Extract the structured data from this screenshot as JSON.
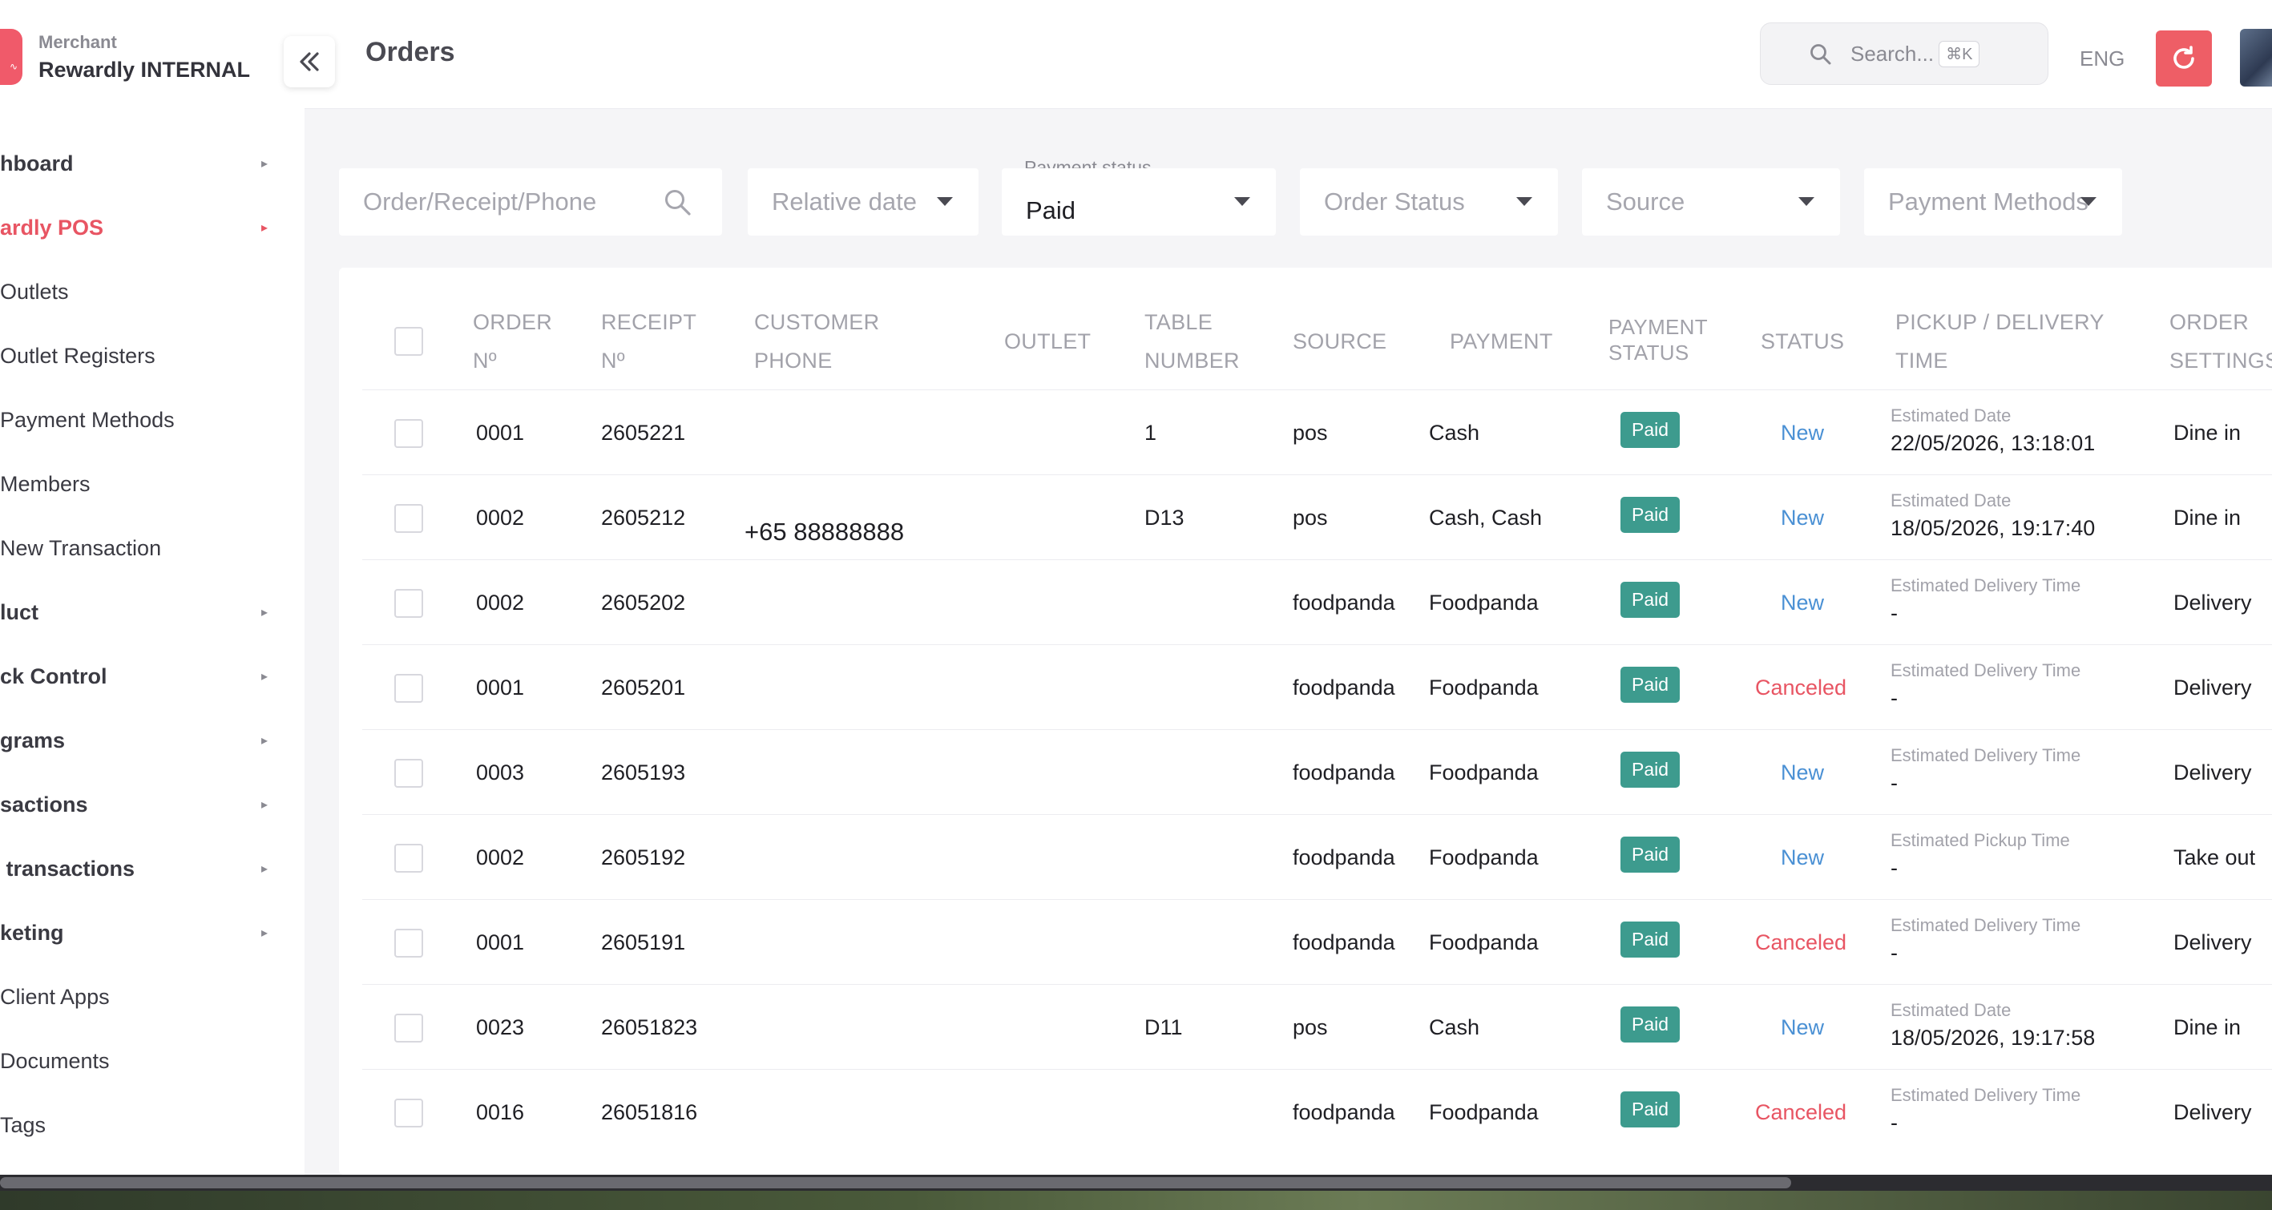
{
  "brand": {
    "subtitle": "Merchant",
    "name": "Rewardly INTERNAL"
  },
  "sidebar": {
    "items": [
      {
        "label": "hboard",
        "type": "section",
        "arrow": "▸"
      },
      {
        "label": "ardly POS",
        "type": "active",
        "arrow": "▸"
      },
      {
        "label": "Outlets",
        "type": "child",
        "arrow": ""
      },
      {
        "label": "Outlet Registers",
        "type": "child",
        "arrow": ""
      },
      {
        "label": "Payment Methods",
        "type": "child",
        "arrow": ""
      },
      {
        "label": "Members",
        "type": "child",
        "arrow": ""
      },
      {
        "label": "New Transaction",
        "type": "child",
        "arrow": ""
      },
      {
        "label": "luct",
        "type": "section",
        "arrow": "▸"
      },
      {
        "label": "ck Control",
        "type": "section",
        "arrow": "▸"
      },
      {
        "label": "grams",
        "type": "section",
        "arrow": "▸"
      },
      {
        "label": "sactions",
        "type": "section",
        "arrow": "▸"
      },
      {
        "label": " transactions",
        "type": "section",
        "arrow": "▸"
      },
      {
        "label": "keting",
        "type": "section",
        "arrow": "▸"
      },
      {
        "label": "Client Apps",
        "type": "child",
        "arrow": ""
      },
      {
        "label": "Documents",
        "type": "child",
        "arrow": ""
      },
      {
        "label": "Tags",
        "type": "child",
        "arrow": ""
      }
    ]
  },
  "header": {
    "title": "Orders",
    "search_placeholder": "Search...",
    "search_shortcut": "⌘K",
    "language": "ENG"
  },
  "filters": {
    "order_search_placeholder": "Order/Receipt/Phone",
    "relative_date": "Relative date",
    "payment_status_label": "Payment status",
    "payment_status_value": "Paid",
    "order_status": "Order Status",
    "source": "Source",
    "payment_methods": "Payment Methods"
  },
  "table": {
    "headers": {
      "order_no_1": "ORDER",
      "order_no_2": "Nº",
      "receipt_no_1": "RECEIPT",
      "receipt_no_2": "Nº",
      "customer_phone_1": "CUSTOMER",
      "customer_phone_2": "PHONE",
      "outlet": "OUTLET",
      "table_number_1": "TABLE",
      "table_number_2": "NUMBER",
      "source": "SOURCE",
      "payment": "PAYMENT",
      "payment_status_1": "PAYMENT",
      "payment_status_2": "STATUS",
      "status": "STATUS",
      "pickup_1": "PICKUP / DELIVERY",
      "pickup_2": "TIME",
      "order_settings_1": "ORDER",
      "order_settings_2": "SETTINGS"
    },
    "rows": [
      {
        "order": "0001",
        "receipt": "2605221",
        "phone": "",
        "table": "1",
        "source": "pos",
        "payment": "Cash",
        "pay_status": "Paid",
        "status": "New",
        "status_kind": "new",
        "time_label": "Estimated Date",
        "time_value": "22/05/2026, 13:18:01",
        "setting": "Dine in"
      },
      {
        "order": "0002",
        "receipt": "2605212",
        "phone": "+65 88888888",
        "table": "D13",
        "source": "pos",
        "payment": "Cash, Cash",
        "pay_status": "Paid",
        "status": "New",
        "status_kind": "new",
        "time_label": "Estimated Date",
        "time_value": "18/05/2026, 19:17:40",
        "setting": "Dine in"
      },
      {
        "order": "0002",
        "receipt": "2605202",
        "phone": "",
        "table": "",
        "source": "foodpanda",
        "payment": "Foodpanda",
        "pay_status": "Paid",
        "status": "New",
        "status_kind": "new",
        "time_label": "Estimated Delivery Time",
        "time_value": "-",
        "setting": "Delivery"
      },
      {
        "order": "0001",
        "receipt": "2605201",
        "phone": "",
        "table": "",
        "source": "foodpanda",
        "payment": "Foodpanda",
        "pay_status": "Paid",
        "status": "Canceled",
        "status_kind": "canceled",
        "time_label": "Estimated Delivery Time",
        "time_value": "-",
        "setting": "Delivery"
      },
      {
        "order": "0003",
        "receipt": "2605193",
        "phone": "",
        "table": "",
        "source": "foodpanda",
        "payment": "Foodpanda",
        "pay_status": "Paid",
        "status": "New",
        "status_kind": "new",
        "time_label": "Estimated Delivery Time",
        "time_value": "-",
        "setting": "Delivery"
      },
      {
        "order": "0002",
        "receipt": "2605192",
        "phone": "",
        "table": "",
        "source": "foodpanda",
        "payment": "Foodpanda",
        "pay_status": "Paid",
        "status": "New",
        "status_kind": "new",
        "time_label": "Estimated Pickup Time",
        "time_value": "-",
        "setting": "Take out"
      },
      {
        "order": "0001",
        "receipt": "2605191",
        "phone": "",
        "table": "",
        "source": "foodpanda",
        "payment": "Foodpanda",
        "pay_status": "Paid",
        "status": "Canceled",
        "status_kind": "canceled",
        "time_label": "Estimated Delivery Time",
        "time_value": "-",
        "setting": "Delivery"
      },
      {
        "order": "0023",
        "receipt": "26051823",
        "phone": "",
        "table": "D11",
        "source": "pos",
        "payment": "Cash",
        "pay_status": "Paid",
        "status": "New",
        "status_kind": "new",
        "time_label": "Estimated Date",
        "time_value": "18/05/2026, 19:17:58",
        "setting": "Dine in"
      },
      {
        "order": "0016",
        "receipt": "26051816",
        "phone": "",
        "table": "",
        "source": "foodpanda",
        "payment": "Foodpanda",
        "pay_status": "Paid",
        "status": "Canceled",
        "status_kind": "canceled",
        "time_label": "Estimated Delivery Time",
        "time_value": "-",
        "setting": "Delivery"
      }
    ]
  },
  "colors": {
    "accent": "#e85563",
    "paid_badge": "#3d9b8e",
    "status_new": "#4a90d4",
    "status_canceled": "#e85563",
    "refresh_button": "#ee5e66"
  },
  "icons": {
    "collapse": "double-chevron-left-icon",
    "search": "search-icon",
    "refresh": "refresh-icon",
    "caret": "caret-down-icon"
  }
}
